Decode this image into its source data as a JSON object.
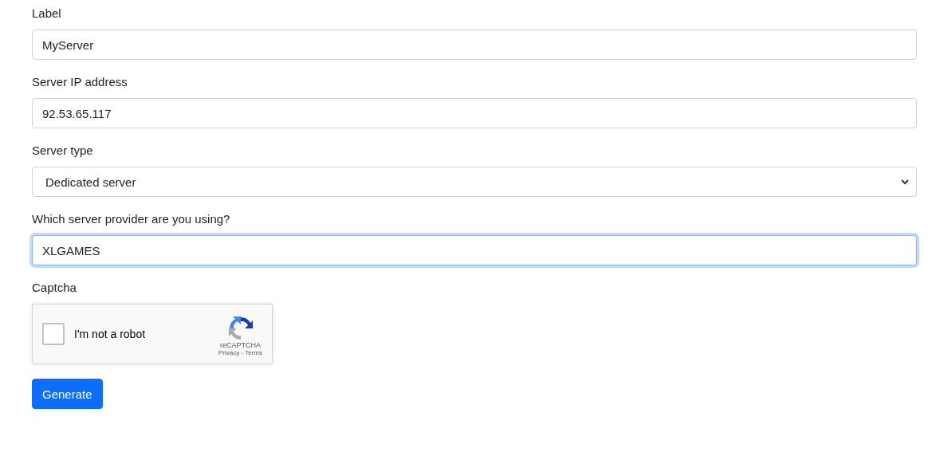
{
  "fields": [
    {
      "label": "Label",
      "kind": "text",
      "value": "MyServer",
      "focused": false
    },
    {
      "label": "Server IP address",
      "kind": "text",
      "value": "92.53.65.117",
      "focused": false
    },
    {
      "label": "Server type",
      "kind": "select",
      "value": "Dedicated server",
      "focused": false
    },
    {
      "label": "Which server provider are you using?",
      "kind": "text",
      "value": "XLGAMES",
      "focused": true
    }
  ],
  "captcha": {
    "label": "Captcha",
    "checkbox_label": "I'm not a robot",
    "checked": false,
    "brand": "reCAPTCHA",
    "links": "Privacy - Terms"
  },
  "submit": "Generate"
}
